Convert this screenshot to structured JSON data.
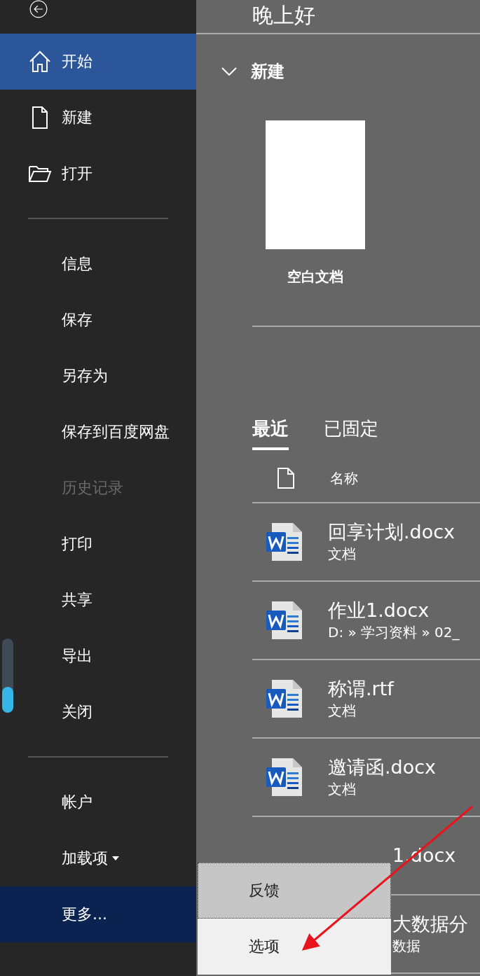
{
  "sidebar": {
    "items": [
      {
        "label": "开始",
        "selected": true,
        "disabled": false
      },
      {
        "label": "新建",
        "selected": false,
        "disabled": false
      },
      {
        "label": "打开",
        "selected": false,
        "disabled": false
      },
      {
        "kind": "divider"
      },
      {
        "label": "信息",
        "selected": false,
        "disabled": false
      },
      {
        "label": "保存",
        "selected": false,
        "disabled": false
      },
      {
        "label": "另存为",
        "selected": false,
        "disabled": false
      },
      {
        "label": "保存到百度网盘",
        "selected": false,
        "disabled": false
      },
      {
        "label": "历史记录",
        "selected": false,
        "disabled": true
      },
      {
        "label": "打印",
        "selected": false,
        "disabled": false
      },
      {
        "label": "共享",
        "selected": false,
        "disabled": false
      },
      {
        "label": "导出",
        "selected": false,
        "disabled": false
      },
      {
        "label": "关闭",
        "selected": false,
        "disabled": false
      },
      {
        "kind": "divider"
      },
      {
        "label": "帐户",
        "selected": false,
        "disabled": false
      },
      {
        "label": "加载项",
        "caret": true,
        "selected": false,
        "disabled": false
      },
      {
        "label": "更多...",
        "selected": false,
        "disabled": false,
        "open": true
      }
    ]
  },
  "slider": {
    "level": 0.35
  },
  "greeting": "晚上好",
  "new_section": {
    "title": "新建",
    "expanded": true,
    "templates": [
      {
        "label": "空白文档"
      }
    ]
  },
  "tabs": [
    {
      "label": "最近",
      "selected": true
    },
    {
      "label": "已固定",
      "selected": false
    }
  ],
  "file_list": {
    "column": "名称",
    "rows": [
      {
        "kind": "file",
        "name": "回享计划.docx",
        "location": "文档"
      },
      {
        "kind": "file",
        "name": "作业1.docx",
        "location": "D: » 学习资料 » 02_"
      },
      {
        "kind": "file",
        "name": "称谓.rtf",
        "location": "文档"
      },
      {
        "kind": "file",
        "name": "邀请函.docx",
        "location": "文档"
      },
      {
        "kind": "covered",
        "name": "1.docx"
      },
      {
        "kind": "covered",
        "name": "大数据分",
        "location": "数据"
      }
    ]
  },
  "more_menu": {
    "items": [
      {
        "label": "反馈",
        "selected": true
      },
      {
        "label": "选项",
        "selected": false
      }
    ]
  }
}
